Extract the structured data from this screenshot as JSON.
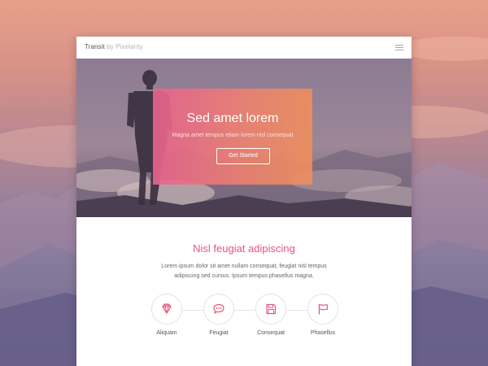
{
  "brand": {
    "name": "Transit",
    "by": "by Pixelarity"
  },
  "nav": {
    "menu_icon": "hamburger-menu-icon"
  },
  "hero": {
    "title": "Sed amet lorem",
    "subtitle": "Magna amet tempus etiam lorem nisl consequat",
    "button_label": "Get Started"
  },
  "intro": {
    "title": "Nisl feugiat adipiscing",
    "text": "Lorem ipsum dolor sit amet nullam consequat, feugiat nisl tempus adipiscing sed cursus. Ipsum tempus phasellus magna."
  },
  "features": [
    {
      "label": "Aliquam",
      "icon": "diamond-icon"
    },
    {
      "label": "Feugiat",
      "icon": "chat-bubble-icon"
    },
    {
      "label": "Consequat",
      "icon": "floppy-disk-icon"
    },
    {
      "label": "Phasellus",
      "icon": "flag-icon"
    }
  ],
  "colors": {
    "accent": "#e5577c",
    "gradient_start": "#e8628e",
    "gradient_end": "#ee8f5c",
    "sky_top": "#e7a08a",
    "sky_bottom": "#786f93"
  }
}
